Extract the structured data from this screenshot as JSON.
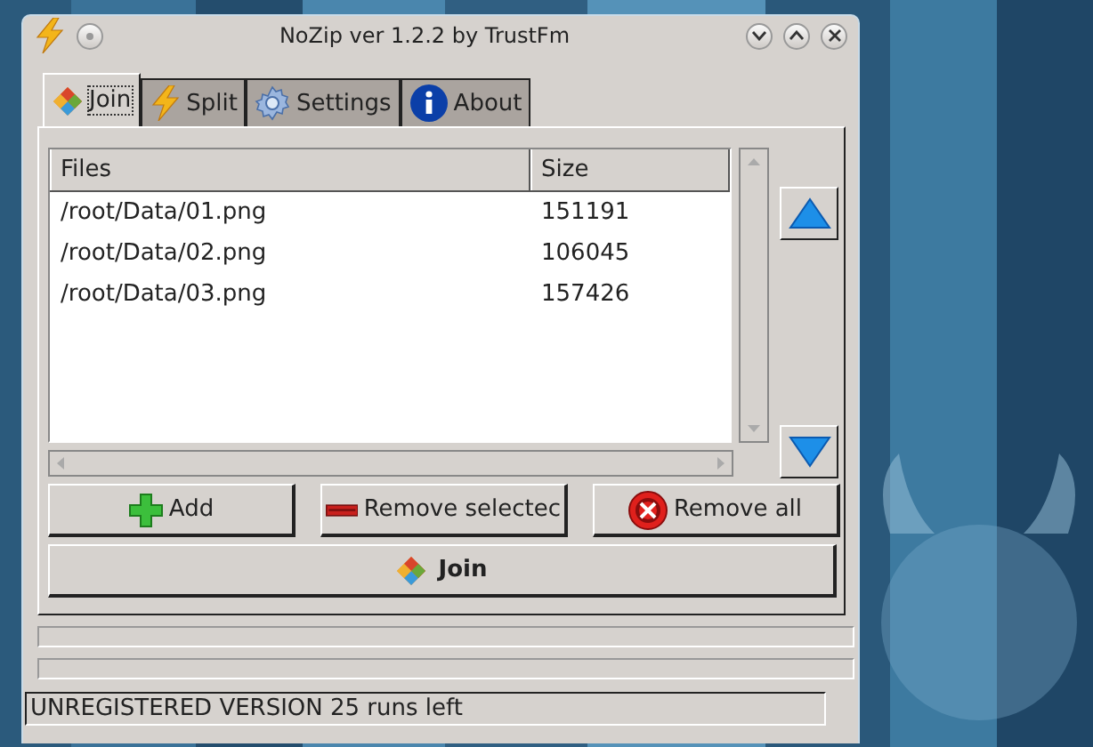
{
  "window": {
    "title": "NoZip ver 1.2.2 by TrustFm"
  },
  "tabs": [
    {
      "label": "Join",
      "selected": true
    },
    {
      "label": "Split",
      "selected": false
    },
    {
      "label": "Settings",
      "selected": false
    },
    {
      "label": "About",
      "selected": false
    }
  ],
  "table": {
    "columns": [
      "Files",
      "Size"
    ],
    "rows": [
      [
        "/root/Data/01.png",
        "151191"
      ],
      [
        "/root/Data/02.png",
        "106045"
      ],
      [
        "/root/Data/03.png",
        "157426"
      ]
    ]
  },
  "buttons": [
    "Add",
    "Remove selectec",
    "Remove all"
  ],
  "join_button": "Join",
  "progress_bars": [
    {
      "level": 0
    },
    {
      "level": 0
    }
  ],
  "status_bar": "UNREGISTERED VERSION 25 runs left"
}
